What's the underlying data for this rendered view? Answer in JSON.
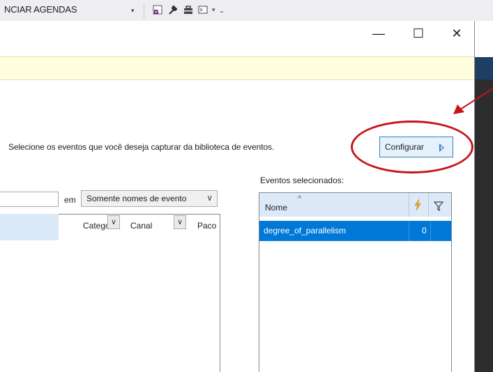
{
  "toolbar": {
    "title": "NCIAR AGENDAS",
    "dropdown_glyph": "▾",
    "more_glyph": "▾",
    "grip_glyph": "₌",
    "icons": [
      "vs-project-icon",
      "wrench-icon",
      "toolbox-icon",
      "console-icon"
    ]
  },
  "window": {
    "minimize": "—",
    "maximize": "☐",
    "close": "✕"
  },
  "dialog": {
    "instruction": "Selecione os eventos que você deseja capturar da biblioteca de eventos.",
    "configure_label": "Configurar",
    "search": {
      "value": "",
      "em_label": "em",
      "scope_value": "Somente nomes de evento",
      "scope_chevron": "∨"
    },
    "library_columns": [
      {
        "label": "Categoria",
        "chevron": "∨"
      },
      {
        "label": "Canal",
        "chevron": "∨"
      },
      {
        "label": "Paco",
        "chevron": ""
      }
    ],
    "selected": {
      "title": "Eventos selecionados:",
      "column_name": "Nome",
      "sort_caret": "^",
      "rows": [
        {
          "name": "degree_of_parallelism",
          "count": "0"
        }
      ]
    }
  },
  "colors": {
    "accent": "#0078d7",
    "highlight_annotation": "#c6141a",
    "infobar": "#fefdde",
    "header_blue": "#dbe9f8"
  }
}
